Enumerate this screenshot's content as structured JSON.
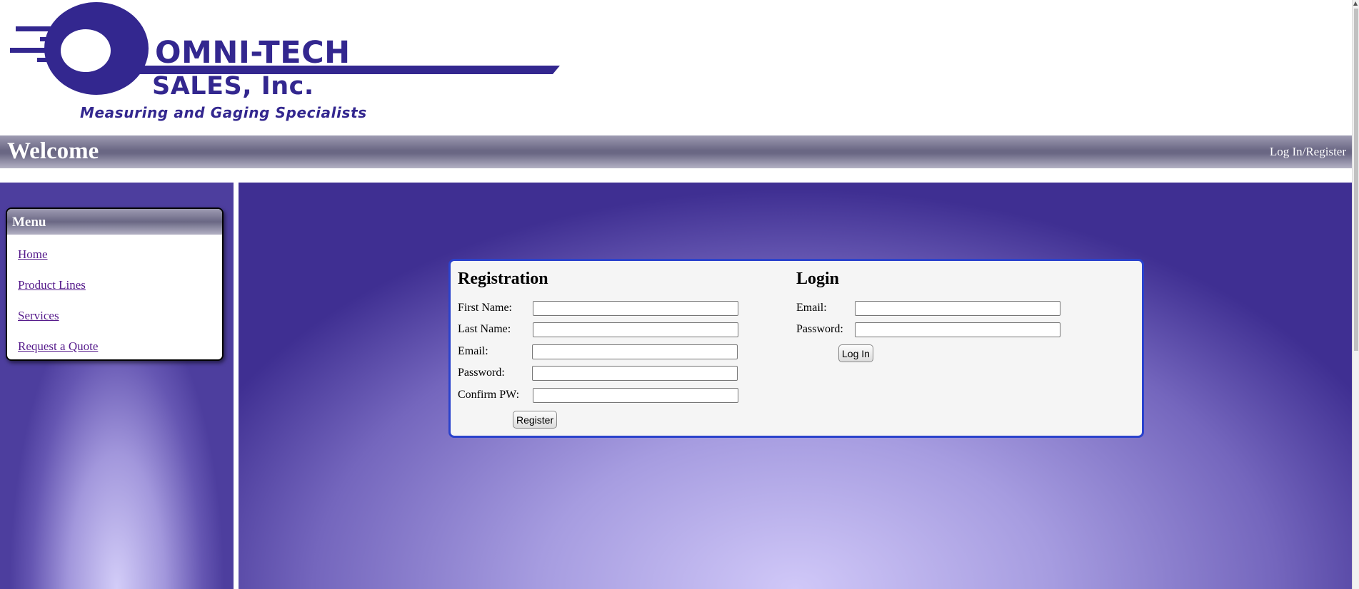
{
  "logo": {
    "name_line1": "OMNI-TECH",
    "name_line2": "SALES, Inc.",
    "tagline": "Measuring and Gaging Specialists",
    "color": "#33278f"
  },
  "header": {
    "title": "Welcome",
    "account_link": "Log In/Register"
  },
  "sidebar": {
    "menu_title": "Menu",
    "items": [
      {
        "label": "Home"
      },
      {
        "label": "Product Lines"
      },
      {
        "label": "Services"
      },
      {
        "label": "Request a Quote"
      }
    ]
  },
  "registration": {
    "title": "Registration",
    "fields": {
      "first_name": {
        "label": "First Name:",
        "value": ""
      },
      "last_name": {
        "label": "Last Name:",
        "value": ""
      },
      "email": {
        "label": "Email:",
        "value": ""
      },
      "password": {
        "label": "Password:",
        "value": ""
      },
      "confirm": {
        "label": "Confirm PW:",
        "value": ""
      }
    },
    "submit_label": "Register"
  },
  "login": {
    "title": "Login",
    "fields": {
      "email": {
        "label": "Email:",
        "value": ""
      },
      "password": {
        "label": "Password:",
        "value": ""
      }
    },
    "submit_label": "Log In"
  },
  "colors": {
    "accent_border": "#2a42cc",
    "brand_purple": "#33278f",
    "link_visited": "#551a8b"
  }
}
